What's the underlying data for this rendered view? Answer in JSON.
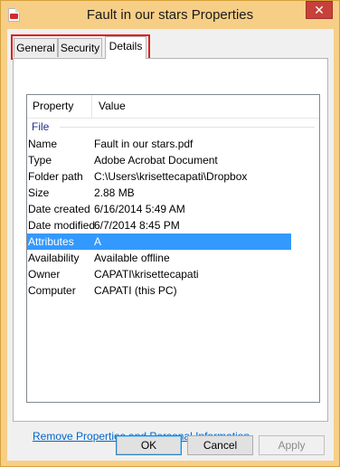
{
  "window": {
    "title": "Fault in our stars Properties",
    "close_label": "✕",
    "icon": "pdf-file-icon"
  },
  "tabs": [
    {
      "label": "General"
    },
    {
      "label": "Security"
    },
    {
      "label": "Details",
      "active": true
    }
  ],
  "list": {
    "headers": {
      "property": "Property",
      "value": "Value"
    },
    "group": "File",
    "rows": [
      {
        "key": "Name",
        "value": "Fault in our stars.pdf"
      },
      {
        "key": "Type",
        "value": "Adobe Acrobat Document"
      },
      {
        "key": "Folder path",
        "value": "C:\\Users\\krisettecapati\\Dropbox"
      },
      {
        "key": "Size",
        "value": "2.88 MB"
      },
      {
        "key": "Date created",
        "value": "6/16/2014 5:49 AM"
      },
      {
        "key": "Date modified",
        "value": "6/7/2014 8:45 PM"
      },
      {
        "key": "Attributes",
        "value": "A",
        "selected": true
      },
      {
        "key": "Availability",
        "value": "Available offline"
      },
      {
        "key": "Owner",
        "value": "CAPATI\\krisettecapati"
      },
      {
        "key": "Computer",
        "value": "CAPATI (this PC)"
      }
    ]
  },
  "link": "Remove Properties and Personal Information",
  "buttons": {
    "ok": "OK",
    "cancel": "Cancel",
    "apply": "Apply"
  },
  "colors": {
    "accent_selection": "#3399ff",
    "highlight_box": "#e02020",
    "titlebar": "#f7ce86"
  }
}
